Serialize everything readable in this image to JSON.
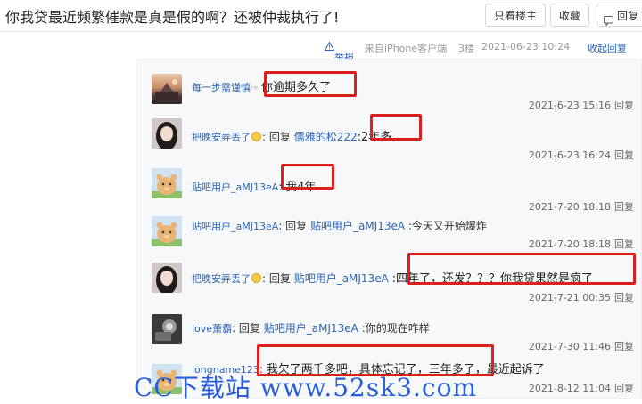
{
  "header": {
    "title": "你我贷最近频繁催款是真是假的啊？还被仲裁执行了!",
    "only_op": "只看楼主",
    "collect": "收藏",
    "reply": "回复"
  },
  "post_meta": {
    "report": "举报",
    "source": "来自iPhone客户端",
    "floor": "3楼",
    "time": "2021-06-23 10:24",
    "collapse": "收起回复"
  },
  "replies": [
    {
      "user": "每一步需谨慎",
      "prefix": "",
      "target": "",
      "text": "你逾期多久了",
      "time": "2021-6-23 15:16",
      "reply": "回复"
    },
    {
      "user": "把晚安弄丢了",
      "prefix": ": 回复 ",
      "target": "儒雅的松222",
      "text": ":2年多。",
      "time": "2021-6-23 16:24",
      "reply": "回复"
    },
    {
      "user": "贴吧用户_aMJ13eA",
      "prefix": "",
      "target": "",
      "text": "我4年",
      "time": "2021-7-20 18:18",
      "reply": "回复"
    },
    {
      "user": "贴吧用户_aMJ13eA",
      "prefix": ": 回复 ",
      "target": "贴吧用户_aMJ13eA",
      "text": ":今天又开始爆炸",
      "time": "2021-7-20 18:18",
      "reply": "回复"
    },
    {
      "user": "把晚安弄丢了",
      "prefix": ": 回复 ",
      "target": "贴吧用户_aMJ13eA",
      "text": ":四年了，还发？？？你我贷果然是疯了",
      "time": "2021-7-21 00:35",
      "reply": "回复"
    },
    {
      "user": "love萧霸",
      "prefix": ": 回复 ",
      "target": "贴吧用户_aMJ13eA",
      "text": ":你的现在咋样",
      "time": "2021-7-30 11:46",
      "reply": "回复"
    },
    {
      "user": "longname123",
      "prefix": "",
      "target": "",
      "text": "我欠了两千多吧，具体忘记了，三年多了，最近起诉了",
      "time": "2021-8-12 11:04",
      "reply": "回复"
    }
  ],
  "watermark": "CC下载站 www.52sk3.com",
  "colors": {
    "link": "#2d64b3",
    "highlight": "#d9211d",
    "watermark": "#2a5ed8"
  }
}
